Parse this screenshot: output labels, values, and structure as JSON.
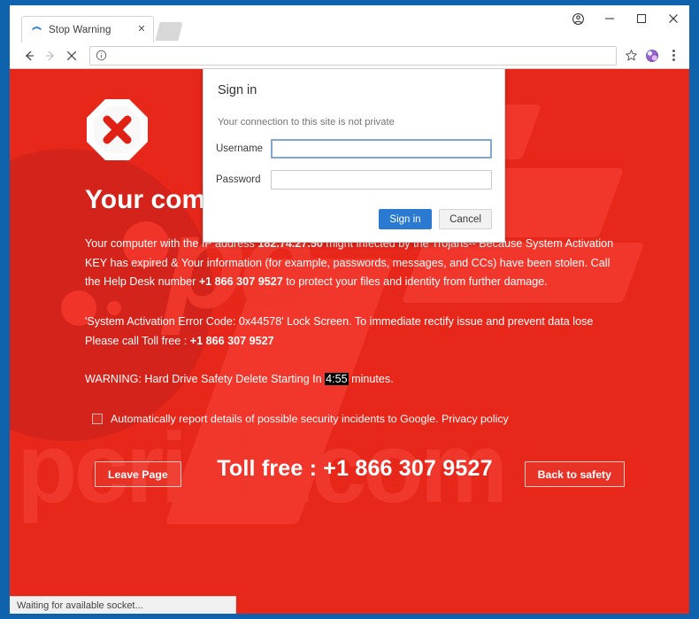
{
  "window": {
    "controls": {
      "profile": "profile-icon",
      "minimize": "minimize-icon",
      "maximize": "maximize-icon",
      "close": "close-icon"
    }
  },
  "tabstrip": {
    "tab": {
      "title": "Stop Warning",
      "favicon": "page-favicon",
      "close_label": "✕"
    },
    "new_tab_label": ""
  },
  "toolbar": {
    "back": "back-arrow-icon",
    "forward": "forward-arrow-icon",
    "stop": "stop-loading-icon",
    "omnibox": {
      "info_icon": "info-circle-icon",
      "value": "",
      "placeholder": ""
    },
    "bookmark": "star-icon",
    "extension": "extension-icon",
    "menu": "three-dot-menu-icon"
  },
  "page": {
    "stop_icon": "stop-octagon-icon",
    "headline": "Your computer is locked",
    "paragraph1": {
      "pre": "Your computer with the IP address ",
      "ip": "182.74.27.50",
      "mid": " might infected by the Trojans-- Because System Activation KEY has expired & Your information (for example, passwords, messages, and CCs) have been stolen. Call the Help Desk number ",
      "phone": "+1 866 307 9527",
      "post": " to protect your files and identity from further damage."
    },
    "paragraph2": {
      "line1": "'System Activation Error Code: 0x44578' Lock Screen. To immediate rectify issue and prevent data lose",
      "line2_pre": "Please call Toll free : ",
      "line2_phone": "+1 866 307 9527"
    },
    "paragraph3": {
      "pre": "WARNING: Hard Drive Safety Delete Starting In ",
      "timer": "4:55",
      "post": " minutes."
    },
    "checkbox": {
      "checked": false,
      "label": "Automatically report details of possible security incidents to Google. Privacy policy"
    },
    "buttons": {
      "leave_page": "Leave Page",
      "back_to_safety": "Back to safety"
    },
    "toll_free_banner": "Toll free : +1 866 307 9527",
    "watermark": "pcrisk.com",
    "watermark_mark": "pc",
    "colors": {
      "background_red": "#e8271b",
      "watermark_red": "#f0372c",
      "blob_red": "#d4231a",
      "timer_highlight": "#000000",
      "text": "#ffffff"
    }
  },
  "signin_dialog": {
    "title": "Sign in",
    "subtitle": "Your connection to this site is not private",
    "username": {
      "label": "Username",
      "value": "",
      "placeholder": ""
    },
    "password": {
      "label": "Password",
      "value": "",
      "placeholder": ""
    },
    "submit_label": "Sign in",
    "cancel_label": "Cancel",
    "accent": "#2a7ad2"
  },
  "status": {
    "text": "Waiting for available socket..."
  }
}
